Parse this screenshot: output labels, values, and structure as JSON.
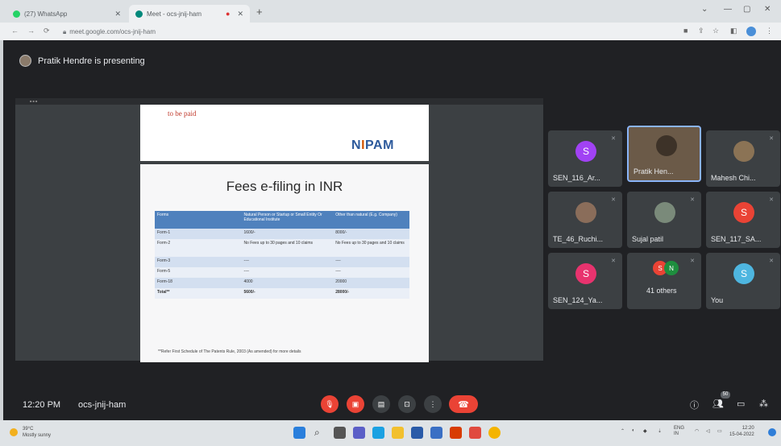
{
  "browser": {
    "tabs": [
      {
        "label": "(27) WhatsApp",
        "favicon_color": "#25d366"
      },
      {
        "label": "Meet - ocs-jnij-ham",
        "favicon_color": "#00897b"
      }
    ],
    "url": "meet.google.com/ocs-jnij-ham"
  },
  "meet": {
    "presenter_banner": "Pratik Hendre is presenting",
    "meeting_time": "12:20 PM",
    "meeting_code": "ocs-jnij-ham",
    "people_count": "50"
  },
  "slide": {
    "top_text": "to be paid",
    "logo": {
      "main": "NIPAM",
      "accent_color": "#d35400",
      "color": "#2d5a9c"
    },
    "title": "Fees e-filing in INR",
    "table": {
      "headers": [
        "Forms",
        "Natural Person or Startup or Small Entity Or Educational Institute",
        "Other than natural (E.g. Company)"
      ],
      "rows": [
        [
          "Form-1",
          "1600/-",
          "8000/-"
        ],
        [
          "Form-2",
          "No Fees up to 30 pages and 10 claims",
          "No Fees up to 30 pages and 10 claims"
        ],
        [
          "Form-3",
          "----",
          "----"
        ],
        [
          "Form-5",
          "----",
          "----"
        ],
        [
          "Form-18",
          "4000",
          "20000"
        ],
        [
          "Total**",
          "5600/-",
          "28000/-"
        ]
      ]
    },
    "footnote": "**Refer First Schedule of The Patents Rule, 2003 (As amended) for more details"
  },
  "participants": [
    {
      "name": "SEN_116_Ar...",
      "initial": "S",
      "color": "#a142f4",
      "type": "initial"
    },
    {
      "name": "Pratik Hen...",
      "initial": "",
      "color": "#6b5a48",
      "type": "video"
    },
    {
      "name": "Mahesh Chi...",
      "initial": "",
      "color": "#8b7355",
      "type": "photo"
    },
    {
      "name": "TE_46_Ruchi...",
      "initial": "",
      "color": "#8a6d5a",
      "type": "photo"
    },
    {
      "name": "Sujal patil",
      "initial": "",
      "color": "#7a8a7a",
      "type": "photo"
    },
    {
      "name": "SEN_117_SA...",
      "initial": "S",
      "color": "#ea4335",
      "type": "initial"
    },
    {
      "name": "SEN_124_Ya...",
      "initial": "S",
      "color": "#e8336e",
      "type": "initial"
    },
    {
      "name": "41 others",
      "initial": "S",
      "color": "#ea4335",
      "initial2": "N",
      "color2": "#1e8e3e",
      "type": "others"
    },
    {
      "name": "You",
      "initial": "S",
      "color": "#4eb6e0",
      "type": "initial"
    }
  ],
  "taskbar": {
    "weather_temp": "39°C",
    "weather_desc": "Mostly sunny",
    "lang": "ENG\nIN",
    "time": "12:20",
    "date": "15-04-2022"
  },
  "colors": {
    "meet_bg": "#202124",
    "tile_bg": "#3c4043",
    "end_call": "#ea4335",
    "table_header": "#4f81bd"
  }
}
